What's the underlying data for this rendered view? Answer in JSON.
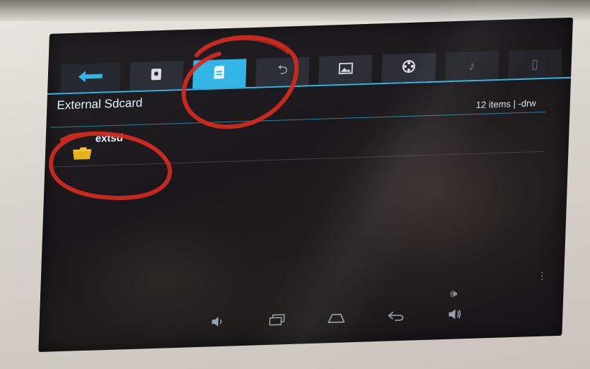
{
  "app": {
    "location_title": "External Sdcard",
    "item_summary": "12 items | -drw"
  },
  "tabs": [
    {
      "label": "",
      "icon": "back-arrow-icon",
      "active": false
    },
    {
      "label": "",
      "icon": "internal-storage-icon",
      "active": false
    },
    {
      "label": "",
      "icon": "sdcard-icon",
      "active": true
    },
    {
      "label": "",
      "icon": "usb-icon",
      "active": false
    },
    {
      "label": "",
      "icon": "image-icon",
      "active": false
    },
    {
      "label": "",
      "icon": "video-icon",
      "active": false
    },
    {
      "label": "",
      "icon": "music-icon",
      "active": false
    },
    {
      "label": "",
      "icon": "document-icon",
      "active": false
    }
  ],
  "files": [
    {
      "name": "extsd",
      "icon": "folder-icon"
    }
  ],
  "navbar": {
    "items": [
      "volume-down-icon",
      "recent-apps-icon",
      "home-icon",
      "back-icon",
      "volume-up-icon"
    ]
  },
  "colors": {
    "accent": "#33b5e5",
    "annotation": "#d42a1f",
    "folder": "#f2c230"
  }
}
